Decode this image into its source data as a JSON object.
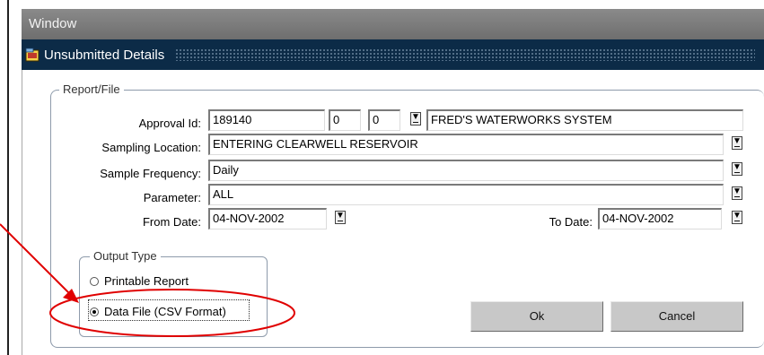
{
  "window_menu": {
    "label": "Window"
  },
  "dialog": {
    "title": "Unsubmitted Details",
    "group_label": "Report/File",
    "fields": {
      "approval_id": {
        "label": "Approval Id:",
        "value": "189140",
        "sub1": "0",
        "sub2": "0",
        "system_name": "FRED'S WATERWORKS SYSTEM"
      },
      "sampling_location": {
        "label": "Sampling Location:",
        "value": "ENTERING CLEARWELL RESERVOIR"
      },
      "sample_frequency": {
        "label": "Sample Frequency:",
        "value": "Daily"
      },
      "parameter": {
        "label": "Parameter:",
        "value": "ALL"
      },
      "from_date": {
        "label": "From Date:",
        "value": "04-NOV-2002"
      },
      "to_date": {
        "label": "To Date:",
        "value": "04-NOV-2002"
      }
    },
    "output_type": {
      "label": "Output Type",
      "options": [
        {
          "label": "Printable Report",
          "selected": false
        },
        {
          "label": "Data File (CSV Format)",
          "selected": true
        }
      ]
    },
    "buttons": {
      "ok": "Ok",
      "cancel": "Cancel"
    }
  },
  "annotation": {
    "color": "#e00000"
  },
  "icons": {
    "dropdown": "dropdown-arrow-icon",
    "app": "app-window-icon"
  }
}
